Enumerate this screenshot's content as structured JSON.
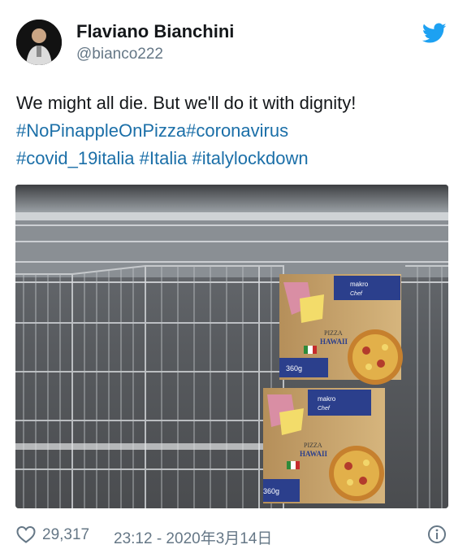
{
  "user": {
    "display_name": "Flaviano Bianchini",
    "handle": "@bianco222"
  },
  "tweet": {
    "line1": "We might all die. But we'll do it with dignity!",
    "line2": [
      "#NoPinappleOnPizza",
      "#coronavirus"
    ],
    "line3": [
      "#covid_19italia",
      "#Italia",
      "#italylockdown"
    ]
  },
  "photo": {
    "products": [
      {
        "brand": "makro",
        "sub": "Chef",
        "name": "PIZZA HAWAII",
        "weight": "360g"
      },
      {
        "brand": "makro",
        "sub": "Chef",
        "name": "PIZZA HAWAII",
        "weight": "360g"
      }
    ]
  },
  "footer": {
    "likes": "29,317",
    "timestamp": "23:12 - 2020年3月14日"
  },
  "icons": [
    "twitter-bird-icon",
    "heart-icon",
    "info-icon"
  ],
  "colors": {
    "link": "#1b6fa8",
    "muted": "#657786",
    "brand": "#1da1f2"
  }
}
